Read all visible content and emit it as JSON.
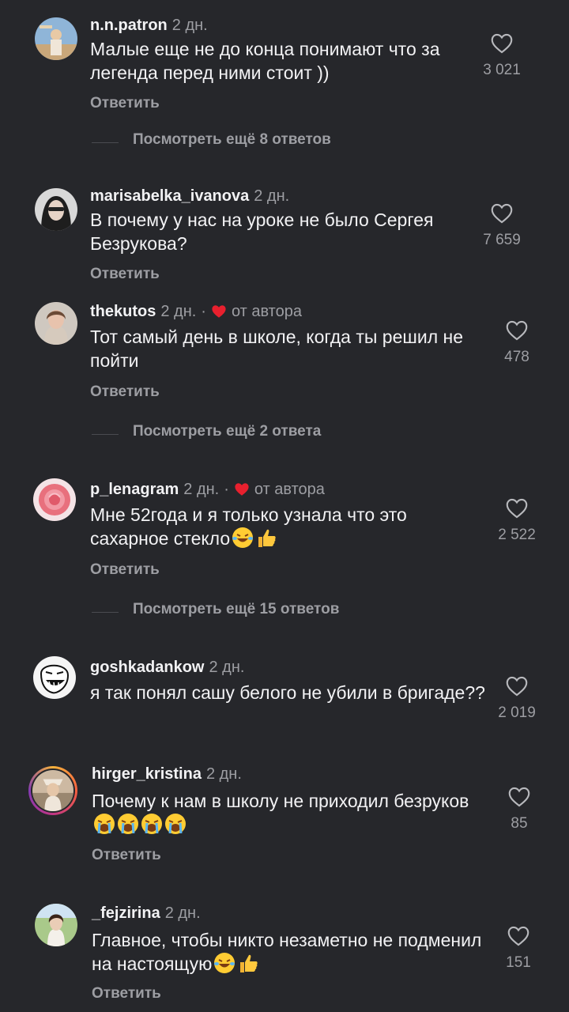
{
  "comments": [
    {
      "username": "n.n.patron",
      "time": "2 дн.",
      "author": "",
      "text": "Малые еще не до конца понимают что за легенда перед ними стоит ))",
      "likes": "3 021",
      "reply": "Ответить",
      "more": "Посмотреть ещё 8 ответов"
    },
    {
      "username": "marisabelka_ivanova",
      "time": "2 дн.",
      "author": "",
      "text": "В почему у нас на уроке не было Сергея Безрукова?",
      "likes": "7 659",
      "reply": "Ответить",
      "more": ""
    },
    {
      "username": "thekutos",
      "time": "2 дн.",
      "author": "от автора",
      "text": "Тот самый день в школе, когда ты решил не пойти",
      "likes": "478",
      "reply": "Ответить",
      "more": "Посмотреть ещё 2 ответа"
    },
    {
      "username": "p_lenagram",
      "time": "2 дн.",
      "author": "от автора",
      "text": "Мне 52года и я только узнала что это сахарное стекло",
      "likes": "2 522",
      "reply": "Ответить",
      "more": "Посмотреть ещё 15 ответов"
    },
    {
      "username": "goshkadankow",
      "time": "2 дн.",
      "author": "",
      "text": "я так понял сашу белого не убили в бригаде??",
      "likes": "2 019",
      "reply": "",
      "more": ""
    },
    {
      "username": "hirger_kristina",
      "time": "2 дн.",
      "author": "",
      "text": "Почему к нам в школу не приходил безруков",
      "likes": "85",
      "reply": "Ответить",
      "more": ""
    },
    {
      "username": "_fejzirina",
      "time": "2 дн.",
      "author": "",
      "text": "Главное, чтобы никто незаметно не подменил на настоящую",
      "likes": "151",
      "reply": "Ответить",
      "more": ""
    }
  ],
  "icons": {
    "like": "heart-outline-icon",
    "author_like": "heart-filled-icon"
  },
  "colors": {
    "background": "#26272b",
    "author_heart": "#e8202e",
    "secondary_text": "#9d9ea3"
  }
}
